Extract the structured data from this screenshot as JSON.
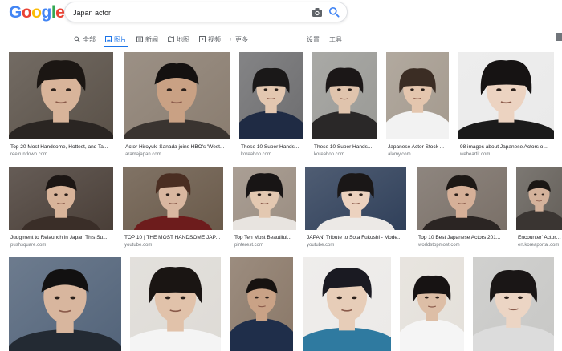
{
  "logo": "Google",
  "search": {
    "query": "Japan actor"
  },
  "tabs": [
    {
      "label": "全部",
      "icon": "search-icon"
    },
    {
      "label": "图片",
      "icon": "image-icon"
    },
    {
      "label": "新闻",
      "icon": "news-icon"
    },
    {
      "label": "地图",
      "icon": "map-icon"
    },
    {
      "label": "视频",
      "icon": "video-icon"
    },
    {
      "label": "更多",
      "icon": "more-icon"
    },
    {
      "label": "设置"
    },
    {
      "label": "工具"
    }
  ],
  "results": [
    {
      "caption": "Top 20 Most Handsome, Hottest, and Ta...",
      "source": "reelrundown.com"
    },
    {
      "caption": "Actor Hiroyuki Sanada joins HBO's 'West...",
      "source": "aramajapan.com"
    },
    {
      "caption": "These 10 Super Hands...",
      "source": "koreaboo.com"
    },
    {
      "caption": "These 10 Super Hands...",
      "source": "koreaboo.com"
    },
    {
      "caption": "Japanese Actor Stock ...",
      "source": "alamy.com"
    },
    {
      "caption": "98 images about Japanese Actors o...",
      "source": "weheartit.com"
    },
    {
      "caption": "Judgment to Relaunch in Japan This Su...",
      "source": "pushsquare.com"
    },
    {
      "caption": "TOP 10 | THE MOST HANDSOME JAPA...",
      "source": "youtube.com"
    },
    {
      "caption": "Top Ten Most Beautiful...",
      "source": "pinterest.com"
    },
    {
      "caption": "JAPAN] Tribute to Sota Fukushi - Mode...",
      "source": "youtube.com"
    },
    {
      "caption": "Top 10 Best Japanese Actors 201...",
      "source": "worldstopmost.com"
    },
    {
      "caption": "Encounter' Actor F...",
      "source": "en.koreaportal.com"
    },
    {
      "caption": "",
      "source": ""
    },
    {
      "caption": "",
      "source": ""
    },
    {
      "caption": "",
      "source": ""
    },
    {
      "caption": "",
      "source": ""
    },
    {
      "caption": "",
      "source": ""
    },
    {
      "caption": "",
      "source": ""
    }
  ]
}
